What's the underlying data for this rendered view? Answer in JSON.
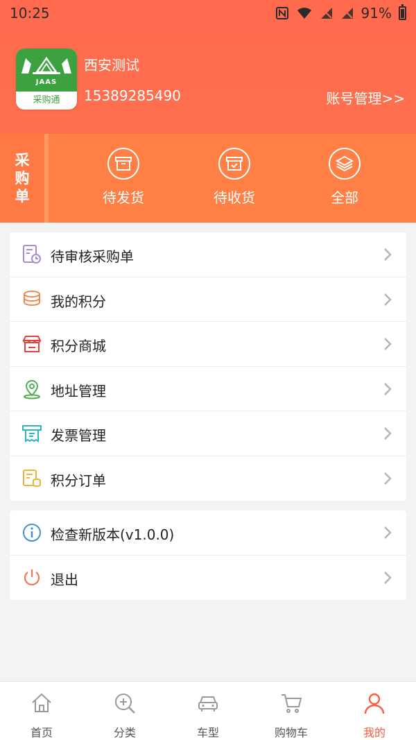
{
  "status": {
    "time": "10:25",
    "battery": "91%"
  },
  "profile": {
    "logo_brand": "JAAS",
    "logo_sub": "采购通",
    "name": "西安测试",
    "phone": "15389285490",
    "account_link": "账号管理>>"
  },
  "orders": {
    "label_chars": [
      "采",
      "购",
      "单"
    ],
    "items": [
      {
        "label": "待发货",
        "icon": "package-icon"
      },
      {
        "label": "待收货",
        "icon": "receive-box-icon"
      },
      {
        "label": "全部",
        "icon": "layers-icon"
      }
    ]
  },
  "menu1": [
    {
      "label": "待审核采购单",
      "icon": "pending-review-icon",
      "color": "#a98ad6"
    },
    {
      "label": "我的积分",
      "icon": "coins-icon",
      "color": "#f08a4b"
    },
    {
      "label": "积分商城",
      "icon": "store-icon",
      "color": "#e8413c"
    },
    {
      "label": "地址管理",
      "icon": "location-pin-icon",
      "color": "#4caf50"
    },
    {
      "label": "发票管理",
      "icon": "invoice-icon",
      "color": "#28b7c9"
    },
    {
      "label": "积分订单",
      "icon": "points-order-icon",
      "color": "#f2b233"
    }
  ],
  "menu2": [
    {
      "label": "检查新版本(v1.0.0)",
      "icon": "info-icon",
      "color": "#3d8fe0"
    },
    {
      "label": "退出",
      "icon": "power-icon",
      "color": "#f07a54"
    }
  ],
  "tabs": [
    {
      "label": "首页",
      "icon": "home-icon"
    },
    {
      "label": "分类",
      "icon": "search-plus-icon"
    },
    {
      "label": "车型",
      "icon": "car-icon"
    },
    {
      "label": "购物车",
      "icon": "cart-icon"
    },
    {
      "label": "我的",
      "icon": "user-icon",
      "active": true
    }
  ],
  "colors": {
    "accent": "#ff5a3c",
    "header": "#ff6a4f",
    "orders_band": "#ff7f44"
  }
}
